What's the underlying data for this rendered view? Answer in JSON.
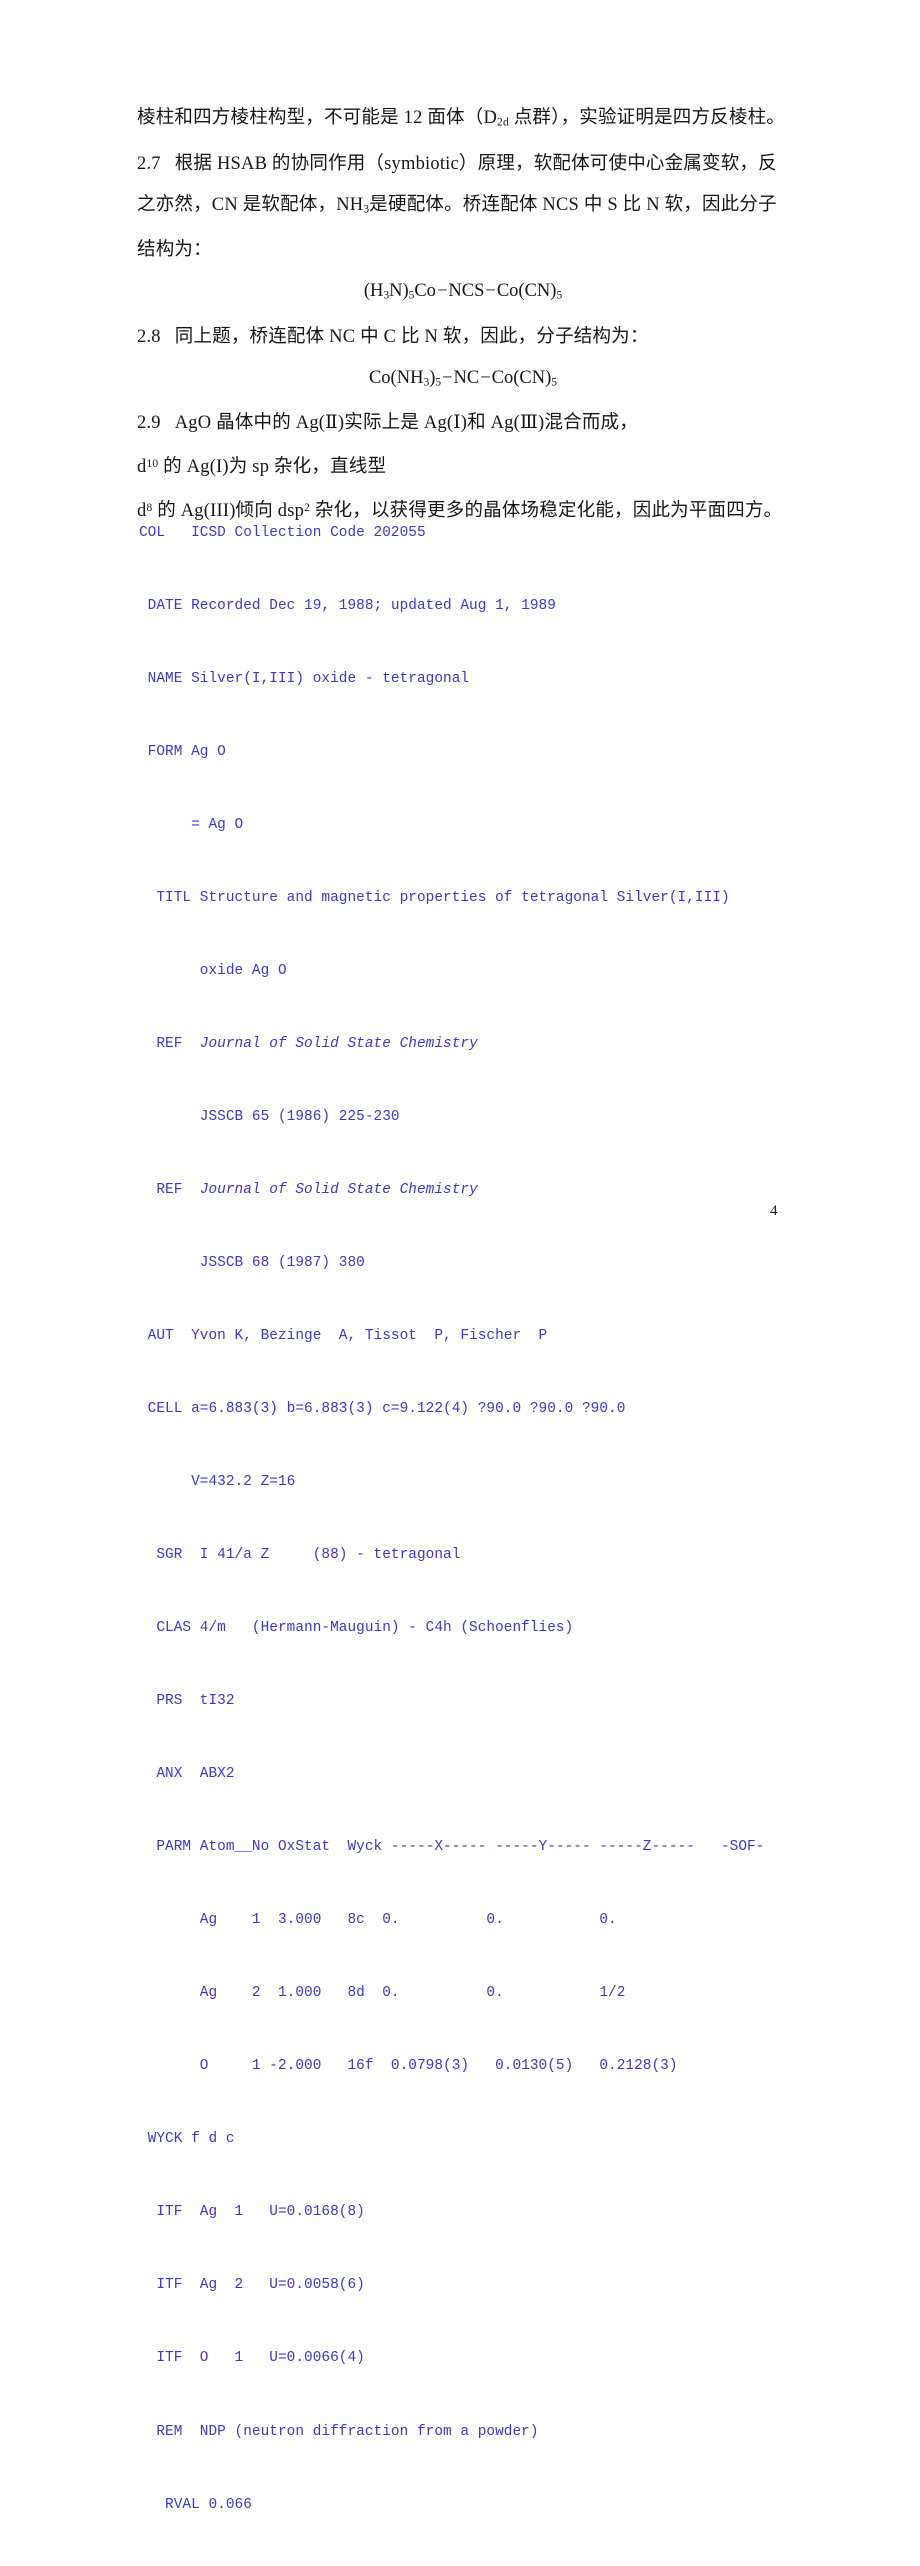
{
  "page": {
    "number": "4",
    "background_color": "#ffffff",
    "prose_color": "#161616",
    "data_block_color": "#3a37cf"
  },
  "prose": {
    "lines": [
      {
        "id": "line-2-6-tail",
        "number": "",
        "text_parts": [
          {
            "t": "棱柱和四方棱柱构型，不可能是 12 面体（D"
          },
          {
            "sub": "2d"
          },
          {
            "t": " 点群），实验证明是四方反棱柱。"
          }
        ],
        "plain": "棱柱和四方棱柱构型，不可能是 12 面体（D2d 点群），实验证明是四方反棱柱。"
      },
      {
        "id": "line-2-7-a",
        "number": "2.7",
        "plain": "根据 HSAB 的协同作用（symbiotic）原理，软配体可使中心金属变软，反"
      },
      {
        "id": "line-2-7-b",
        "number": "",
        "plain": "之亦然，CN 是软配体，NH3 是硬配体。桥连配体 NCS 中 S 比 N 软，因此分子"
      },
      {
        "id": "line-2-7-c",
        "number": "",
        "plain": "结构为："
      },
      {
        "id": "line-2-8",
        "number": "2.8",
        "plain": "同上题，桥连配体 NC 中 C 比 N 软，因此，分子结构为："
      },
      {
        "id": "line-2-9-a",
        "number": "2.9",
        "plain": "AgO 晶体中的 Ag(Ⅱ)实际上是 Ag(Ⅰ)和 Ag(Ⅲ)混合而成，"
      },
      {
        "id": "line-2-9-b",
        "number": "",
        "plain": "d10 的 Ag(I)为 sp 杂化，直线型"
      },
      {
        "id": "line-2-9-c",
        "number": "",
        "plain": "d8 的 Ag(III)倾向 dsp2 杂化，以获得更多的晶体场稳定化能，因此为平面四方。"
      }
    ],
    "l1_pre": "棱柱和四方棱柱构型，不可能是 12 面体（D",
    "l1_sub": "2d",
    "l1_post": " 点群），实验证明是四方反棱柱。",
    "l2_num": "2.7",
    "l2_text": "根据 HSAB 的协同作用（symbiotic）原理，软配体可使中心金属变软，反",
    "l3_pre": "之亦然，CN 是软配体，NH",
    "l3_sub": "3",
    "l3_post": "是硬配体。桥连配体 NCS 中  S 比 N 软，因此分子",
    "l4_text": "结构为：",
    "l5_num": "2.8",
    "l5_text": "同上题，桥连配体 NC 中  C 比 N 软，因此，分子结构为：",
    "l6_num": "2.9",
    "l6_text": "AgO 晶体中的 Ag(Ⅱ)实际上是 Ag(Ⅰ)和 Ag(Ⅲ)混合而成，",
    "l7_pre": "d",
    "l7_sup": "10",
    "l7_post": " 的 Ag(I)为 sp 杂化，直线型",
    "l8_pre": "d",
    "l8_sup": "8",
    "l8_post": " 的 Ag(III)倾向 dsp",
    "l8_sup2": "2",
    "l8_tail": " 杂化，以获得更多的晶体场稳定化能，因此为平面四方。"
  },
  "formulas": [
    {
      "id": "formula-1",
      "plain": "(H3N)5Co−NCS−Co(CN)5",
      "p1": "(H",
      "s1": "3",
      "p2": "N)",
      "s2": "5",
      "p3": "Co",
      "bond1": "−",
      "p4": "NCS",
      "bond2": "−",
      "p5": "Co(CN)",
      "s3": "5"
    },
    {
      "id": "formula-2",
      "plain": "Co(NH3)5−NC−Co(CN)5",
      "p1": "Co(NH",
      "s1": "3",
      "p2": ")",
      "s2": "5",
      "p3": "",
      "bond1": "−",
      "p4": "NC",
      "bond2": "−",
      "p5": "Co(CN)",
      "s3": "5"
    }
  ],
  "icsd_record": {
    "collection_code": "202055",
    "lines": [
      "COL   ICSD Collection Code 202055",
      " DATE Recorded Dec 19, 1988; updated Aug 1, 1989",
      " NAME Silver(I,III) oxide - tetragonal",
      " FORM Ag O",
      "      = Ag O",
      "  TITL Structure and magnetic properties of tetragonal Silver(I,III)",
      "       oxide Ag O",
      "  REF  Journal of Solid State Chemistry",
      "       JSSCB 65 (1986) 225-230",
      "  REF  Journal of Solid State Chemistry",
      "       JSSCB 68 (1987) 380",
      " AUT  Yvon K, Bezinge  A, Tissot  P, Fischer  P",
      " CELL a=6.883(3) b=6.883(3) c=9.122(4) ?90.0 ?90.0 ?90.0",
      "      V=432.2 Z=16",
      "  SGR  I 41/a Z     (88) - tetragonal",
      "  CLAS 4/m   (Hermann-Mauguin) - C4h (Schoenflies)",
      "  PRS  tI32",
      "  ANX  ABX2",
      "  PARM Atom__No OxStat  Wyck -----X----- -----Y----- -----Z-----   -SOF-",
      "       Ag    1  3.000   8c  0.          0.           0.",
      "       Ag    2  1.000   8d  0.          0.           1/2",
      "       O     1 -2.000   16f  0.0798(3)   0.0130(5)   0.2128(3)",
      " WYCK f d c",
      "  ITF  Ag  1   U=0.0168(8)",
      "  ITF  Ag  2   U=0.0058(6)",
      "  ITF  O   1   U=0.0066(4)",
      "  REM  NDP (neutron diffraction from a powder)",
      "   RVAL 0.066"
    ],
    "fields": {
      "COL": "ICSD Collection Code 202055",
      "DATE": "Recorded Dec 19, 1988; updated Aug 1, 1989",
      "NAME": "Silver(I,III) oxide - tetragonal",
      "FORM": "Ag O",
      "FORM_ALT": "= Ag O",
      "TITL": "Structure and magnetic properties of tetragonal Silver(I,III) oxide Ag O",
      "REF_1_journal": "Journal of Solid State Chemistry",
      "REF_1_citation": "JSSCB 65 (1986) 225-230",
      "REF_2_journal": "Journal of Solid State Chemistry",
      "REF_2_citation": "JSSCB 68 (1987) 380",
      "AUT": "Yvon K, Bezinge  A, Tissot  P, Fischer  P",
      "CELL": "a=6.883(3) b=6.883(3) c=9.122(4) ?90.0 ?90.0 ?90.0",
      "CELL_2": "V=432.2 Z=16",
      "SGR": "I 41/a Z     (88) - tetragonal",
      "CLAS": "4/m   (Hermann-Mauguin) - C4h (Schoenflies)",
      "PRS": "tI32",
      "ANX": "ABX2",
      "WYCK": "f d c",
      "REM": "NDP (neutron diffraction from a powder)",
      "RVAL": "0.066"
    },
    "parm_header": "Atom__No OxStat  Wyck -----X----- -----Y----- -----Z-----   -SOF-",
    "parm_rows": [
      {
        "atom": "Ag",
        "no": "1",
        "oxstat": "3.000",
        "wyck": "8c",
        "x": "0.",
        "y": "0.",
        "z": "0."
      },
      {
        "atom": "Ag",
        "no": "2",
        "oxstat": "1.000",
        "wyck": "8d",
        "x": "0.",
        "y": "0.",
        "z": "1/2"
      },
      {
        "atom": "O",
        "no": "1",
        "oxstat": "-2.000",
        "wyck": "16f",
        "x": "0.0798(3)",
        "y": "0.0130(5)",
        "z": "0.2128(3)"
      }
    ],
    "itf_rows": [
      {
        "atom": "Ag",
        "no": "1",
        "u": "U=0.0168(8)"
      },
      {
        "atom": "Ag",
        "no": "2",
        "u": "U=0.0058(6)"
      },
      {
        "atom": "O",
        "no": "1",
        "u": "U=0.0066(4)"
      }
    ],
    "labels": {
      "COL": "COL",
      "DATE": "DATE",
      "NAME": "NAME",
      "FORM": "FORM",
      "TITL": "TITL",
      "REF": "REF",
      "AUT": "AUT",
      "CELL": "CELL",
      "SGR": "SGR",
      "CLAS": "CLAS",
      "PRS": "PRS",
      "ANX": "ANX",
      "PARM": "PARM",
      "WYCK": "WYCK",
      "ITF": "ITF",
      "REM": "REM",
      "RVAL": "RVAL"
    }
  }
}
